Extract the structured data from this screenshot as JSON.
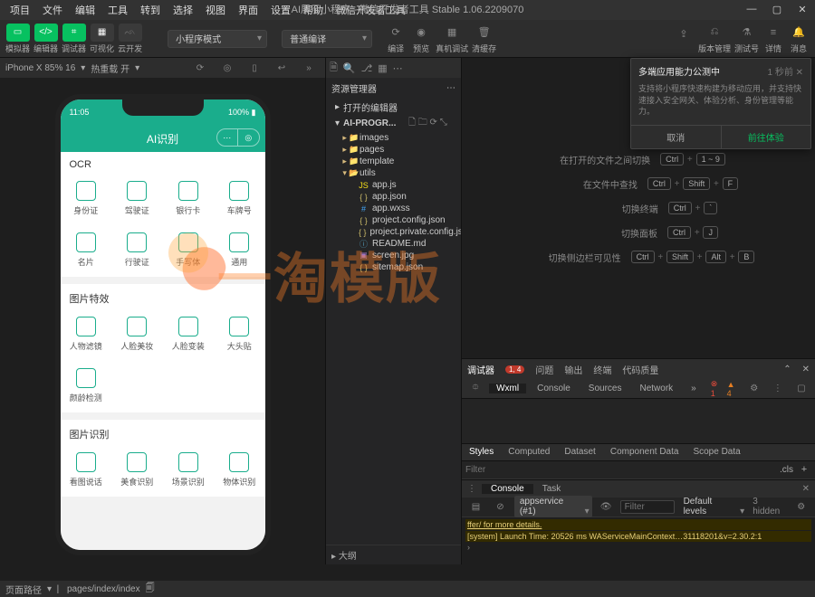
{
  "window": {
    "title": "AI展示小程序 - 微信开发者工具 Stable 1.06.2209070"
  },
  "menu": [
    "项目",
    "文件",
    "编辑",
    "工具",
    "转到",
    "选择",
    "视图",
    "界面",
    "设置",
    "帮助",
    "微信开发者工具"
  ],
  "toolbar": {
    "groups": [
      {
        "label": "模拟器",
        "active": true
      },
      {
        "label": "编辑器",
        "active": true
      },
      {
        "label": "调试器",
        "active": true
      },
      {
        "label": "可视化",
        "active": false
      },
      {
        "label": "云开发",
        "active": false
      }
    ],
    "mode_select": "小程序模式",
    "compile_select": "普通编译",
    "actions": [
      "编译",
      "预览",
      "真机调试",
      "清缓存"
    ],
    "right_actions": [
      "版本管理",
      "测试号",
      "详情",
      "消息"
    ]
  },
  "simulator": {
    "device": "iPhone X 85% 16",
    "hot_reload": "热重载 开",
    "status_time": "11:05",
    "battery": "100%",
    "app_title": "AI识别",
    "sections": [
      {
        "title": "OCR",
        "items": [
          "身份证",
          "驾驶证",
          "银行卡",
          "车牌号",
          "名片",
          "行驶证",
          "手写体",
          "通用"
        ]
      },
      {
        "title": "图片特效",
        "items": [
          "人物滤镜",
          "人脸美妆",
          "人脸变装",
          "大头贴",
          "颜龄检测"
        ]
      },
      {
        "title": "图片识别",
        "items": [
          "看图说话",
          "美食识别",
          "场景识别",
          "物体识别"
        ]
      }
    ]
  },
  "explorer": {
    "title": "资源管理器",
    "open_editors": "打开的编辑器",
    "root": "AI-PROGR...",
    "tree": [
      {
        "name": "images",
        "type": "folder"
      },
      {
        "name": "pages",
        "type": "folder"
      },
      {
        "name": "template",
        "type": "folder"
      },
      {
        "name": "utils",
        "type": "folder-open",
        "children": [
          {
            "name": "app.js",
            "type": "js"
          },
          {
            "name": "app.json",
            "type": "json"
          },
          {
            "name": "app.wxss",
            "type": "wxss"
          },
          {
            "name": "project.config.json",
            "type": "json"
          },
          {
            "name": "project.private.config.js...",
            "type": "json"
          },
          {
            "name": "README.md",
            "type": "md"
          },
          {
            "name": "screen.jpg",
            "type": "img"
          },
          {
            "name": "sitemap.json",
            "type": "json"
          }
        ]
      }
    ],
    "outline": "大纲"
  },
  "popup": {
    "title": "多端应用能力公测中",
    "time": "1 秒前",
    "body": "支持将小程序快速构建为移动应用，并支持快速接入安全网关、体验分析、身份管理等能力。",
    "cancel": "取消",
    "ok": "前往体验"
  },
  "shortcuts": [
    {
      "text": "在打开的文件之间切换",
      "keys": [
        "Ctrl",
        "1 ~ 9"
      ]
    },
    {
      "text": "在文件中查找",
      "keys": [
        "Ctrl",
        "Shift",
        "F"
      ]
    },
    {
      "text": "切换终端",
      "keys": [
        "Ctrl",
        "`"
      ]
    },
    {
      "text": "切换面板",
      "keys": [
        "Ctrl",
        "J"
      ]
    },
    {
      "text": "切换侧边栏可见性",
      "keys": [
        "Ctrl",
        "Shift",
        "Alt",
        "B"
      ]
    }
  ],
  "devtools": {
    "top_tabs": [
      "调试器",
      "问题",
      "输出",
      "终端",
      "代码质量"
    ],
    "badge": "1, 4",
    "inspector_tabs": [
      "Wxml",
      "Console",
      "Sources",
      "Network"
    ],
    "err_count": "1",
    "warn_count": "4",
    "styles_tabs": [
      "Styles",
      "Computed",
      "Dataset",
      "Component Data",
      "Scope Data"
    ],
    "filter_placeholder": "Filter",
    "cls_label": ".cls",
    "console_tabs": [
      "Console",
      "Task"
    ],
    "context": "appservice (#1)",
    "console_filter": "Filter",
    "levels": "Default levels",
    "hidden": "3 hidden",
    "lines": [
      "ffer/ for more details.",
      "[system] Launch Time: 20526 ms   WAServiceMainContext…31118201&v=2.30.2:1"
    ]
  },
  "footer": {
    "route_label": "页面路径",
    "route_value": "pages/index/index"
  }
}
